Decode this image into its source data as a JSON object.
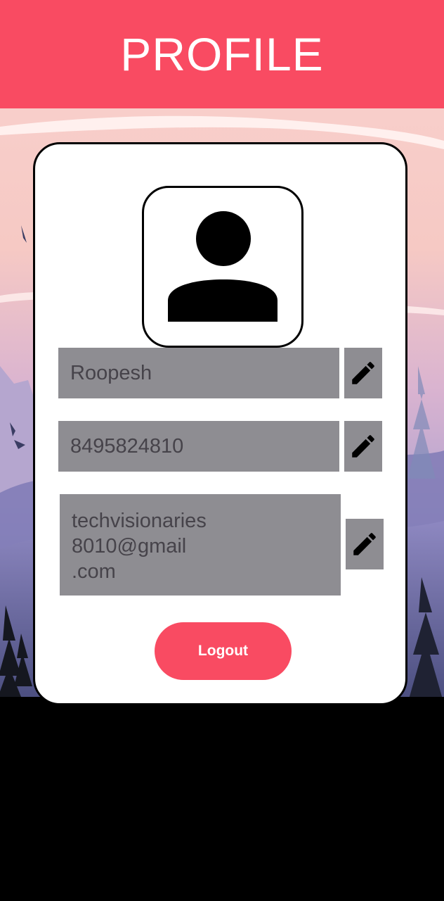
{
  "header": {
    "title": "PROFILE"
  },
  "profile": {
    "name": "Roopesh",
    "phone": "8495824810",
    "email": "techvisionaries\n8010@gmail\n.com"
  },
  "actions": {
    "logout_label": "Logout"
  },
  "icons": {
    "avatar": "person-icon",
    "edit": "pencil-icon"
  },
  "colors": {
    "accent": "#f94b62",
    "field_bg": "#8e8d92",
    "field_text": "#46434a"
  }
}
